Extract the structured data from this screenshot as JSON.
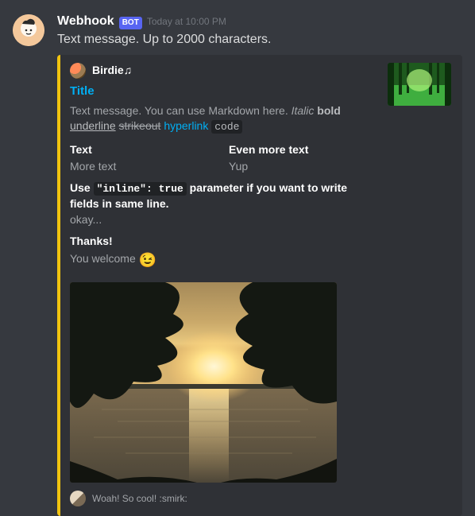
{
  "message": {
    "username": "Webhook",
    "bot_tag": "BOT",
    "timestamp": "Today at 10:00 PM",
    "content": "Text message. Up to 2000 characters."
  },
  "embed": {
    "accent_color": "#f1c40f",
    "author": {
      "name": "Birdie♫"
    },
    "title": "Title",
    "description": {
      "prefix": "Text message. You can use Markdown here. ",
      "italic": "Italic",
      "bold": "bold",
      "underline": "underline",
      "strikeout": "strikeout",
      "hyperlink": "hyperlink",
      "code": "code"
    },
    "fields": [
      {
        "name": "Text",
        "value": "More text",
        "inline": true
      },
      {
        "name": "Even more text",
        "value": "Yup",
        "inline": true
      },
      {
        "name_pre": "Use ",
        "name_code": "\"inline\": true",
        "name_post": " parameter if you want to write fields in same line.",
        "value": "okay...",
        "inline": false
      },
      {
        "name": "Thanks!",
        "value": "You welcome ",
        "emoji": "😉",
        "inline": false
      }
    ],
    "thumbnail_alt": "forest-thumbnail",
    "image_alt": "sunset-over-water",
    "footer": {
      "text": "Woah! So cool! :smirk:"
    }
  }
}
